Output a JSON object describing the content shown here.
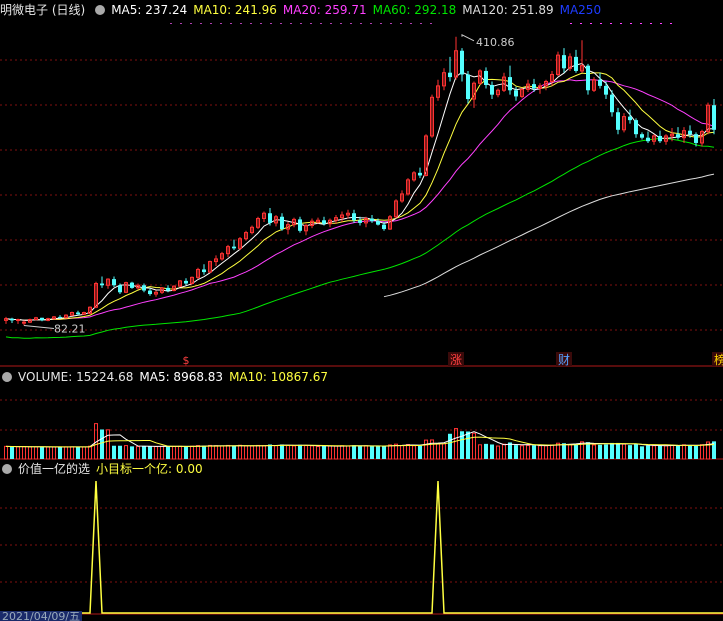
{
  "colors": {
    "up": "#ff3232",
    "down": "#54ffff",
    "grid": "#7f1010",
    "ma5": "#ffffff",
    "ma10": "#ffff40",
    "ma20": "#ff40ff",
    "ma60": "#00e600",
    "ma120": "#dcdcdc",
    "ma250": "#1e3cff",
    "signal": "#ffff40"
  },
  "header": {
    "stock_name": "明微电子 (日线)",
    "ma5": "MA5: 237.24",
    "ma10": "MA10: 241.96",
    "ma20": "MA20: 259.71",
    "ma60": "MA60: 292.18",
    "ma120": "MA120: 251.89",
    "ma250": "MA250"
  },
  "volume_header": {
    "title": "VOLUME: 15224.68",
    "ma5": "MA5: 8968.83",
    "ma10": "MA10: 10867.67"
  },
  "indicator_header": {
    "title": "价值一亿的选",
    "value": "小目标一个亿: 0.00"
  },
  "markers": [
    {
      "label": "$",
      "color": "#ff4040",
      "bar": 30
    },
    {
      "label": "涨",
      "color": "#ff4040",
      "bar": 75
    },
    {
      "label": "财",
      "color": "#54a0ff",
      "bar": 93
    },
    {
      "label": "榜",
      "color": "#ffd700",
      "bar": 119
    }
  ],
  "date_label": "2021/04/09/五",
  "chart_data": [
    {
      "type": "candlestick",
      "title": "明微电子 (日线)",
      "ylim": [
        60,
        430
      ],
      "annotations": [
        {
          "text": "410.86",
          "bar": 76,
          "value": 410.86,
          "kind": "high"
        },
        {
          "text": "82.21",
          "bar": 3,
          "value": 82.21,
          "kind": "low"
        }
      ],
      "series": [
        {
          "name": "MA5",
          "value": 237.24
        },
        {
          "name": "MA10",
          "value": 241.96
        },
        {
          "name": "MA20",
          "value": 259.71
        },
        {
          "name": "MA60",
          "value": 292.18
        },
        {
          "name": "MA120",
          "value": 251.89
        },
        {
          "name": "MA250"
        }
      ],
      "ohlc": [
        [
          88,
          92,
          84,
          90
        ],
        [
          90,
          91,
          85,
          88
        ],
        [
          88,
          90,
          84,
          89
        ],
        [
          85,
          88,
          82.21,
          86
        ],
        [
          86,
          90,
          85,
          89
        ],
        [
          89,
          92,
          88,
          91
        ],
        [
          91,
          91,
          87,
          88
        ],
        [
          88,
          91,
          87,
          90
        ],
        [
          90,
          93,
          89,
          92
        ],
        [
          92,
          94,
          90,
          91
        ],
        [
          91,
          95,
          90,
          94
        ],
        [
          94,
          98,
          93,
          97
        ],
        [
          97,
          99,
          94,
          95
        ],
        [
          95,
          98,
          94,
          97
        ],
        [
          96,
          104,
          95,
          103
        ],
        [
          103,
          132,
          102,
          130
        ],
        [
          130,
          138,
          125,
          128
        ],
        [
          128,
          136,
          124,
          135
        ],
        [
          135,
          138,
          126,
          128
        ],
        [
          128,
          130,
          118,
          120
        ],
        [
          120,
          132,
          119,
          131
        ],
        [
          131,
          132,
          124,
          125
        ],
        [
          125,
          130,
          123,
          128
        ],
        [
          128,
          130,
          120,
          122
        ],
        [
          122,
          124,
          116,
          118
        ],
        [
          118,
          122,
          115,
          120
        ],
        [
          120,
          126,
          118,
          125
        ],
        [
          125,
          128,
          120,
          122
        ],
        [
          122,
          128,
          121,
          127
        ],
        [
          127,
          134,
          126,
          133
        ],
        [
          133,
          136,
          128,
          130
        ],
        [
          130,
          138,
          129,
          137
        ],
        [
          137,
          148,
          135,
          146
        ],
        [
          146,
          152,
          140,
          143
        ],
        [
          143,
          156,
          142,
          155
        ],
        [
          155,
          162,
          150,
          158
        ],
        [
          158,
          166,
          156,
          164
        ],
        [
          164,
          174,
          160,
          172
        ],
        [
          172,
          180,
          168,
          170
        ],
        [
          170,
          183,
          168,
          181
        ],
        [
          181,
          190,
          179,
          188
        ],
        [
          188,
          196,
          186,
          194
        ],
        [
          194,
          206,
          192,
          204
        ],
        [
          204,
          212,
          200,
          210
        ],
        [
          210,
          216,
          196,
          199
        ],
        [
          199,
          208,
          195,
          206
        ],
        [
          206,
          210,
          190,
          192
        ],
        [
          192,
          200,
          186,
          197
        ],
        [
          197,
          205,
          194,
          203
        ],
        [
          203,
          206,
          188,
          190
        ],
        [
          190,
          198,
          185,
          196
        ],
        [
          196,
          204,
          193,
          201
        ],
        [
          200,
          205,
          198,
          202
        ],
        [
          202,
          206,
          196,
          198
        ],
        [
          198,
          204,
          194,
          202
        ],
        [
          202,
          208,
          198,
          205
        ],
        [
          205,
          212,
          200,
          208
        ],
        [
          208,
          214,
          204,
          210
        ],
        [
          210,
          214,
          199,
          202
        ],
        [
          202,
          206,
          196,
          199
        ],
        [
          199,
          206,
          194,
          204
        ],
        [
          204,
          208,
          199,
          201
        ],
        [
          201,
          204,
          196,
          197
        ],
        [
          197,
          200,
          190,
          192
        ],
        [
          192,
          208,
          191,
          206
        ],
        [
          206,
          226,
          204,
          224
        ],
        [
          224,
          236,
          222,
          232
        ],
        [
          232,
          250,
          230,
          248
        ],
        [
          248,
          258,
          246,
          256
        ],
        [
          256,
          262,
          250,
          253
        ],
        [
          253,
          300,
          252,
          298
        ],
        [
          298,
          345,
          296,
          342
        ],
        [
          342,
          362,
          338,
          355
        ],
        [
          355,
          375,
          350,
          370
        ],
        [
          370,
          388,
          360,
          365
        ],
        [
          365,
          410.86,
          362,
          395
        ],
        [
          395,
          398,
          360,
          368
        ],
        [
          368,
          372,
          335,
          340
        ],
        [
          340,
          360,
          330,
          358
        ],
        [
          358,
          374,
          356,
          372
        ],
        [
          372,
          376,
          352,
          356
        ],
        [
          356,
          360,
          340,
          345
        ],
        [
          345,
          352,
          342,
          350
        ],
        [
          350,
          370,
          348,
          365
        ],
        [
          365,
          378,
          345,
          350
        ],
        [
          350,
          354,
          338,
          343
        ],
        [
          343,
          353,
          341,
          351
        ],
        [
          351,
          362,
          348,
          357
        ],
        [
          357,
          363,
          348,
          352
        ],
        [
          352,
          358,
          346,
          355
        ],
        [
          355,
          362,
          350,
          360
        ],
        [
          360,
          372,
          355,
          368
        ],
        [
          368,
          394,
          366,
          390
        ],
        [
          390,
          398,
          370,
          375
        ],
        [
          375,
          392,
          372,
          388
        ],
        [
          388,
          396,
          370,
          372
        ],
        [
          372,
          407,
          370,
          378
        ],
        [
          378,
          380,
          345,
          350
        ],
        [
          350,
          365,
          348,
          362
        ],
        [
          362,
          370,
          352,
          355
        ],
        [
          355,
          360,
          340,
          345
        ],
        [
          345,
          350,
          320,
          325
        ],
        [
          325,
          330,
          300,
          305
        ],
        [
          305,
          324,
          302,
          320
        ],
        [
          320,
          328,
          312,
          316
        ],
        [
          316,
          318,
          296,
          300
        ],
        [
          300,
          302,
          294,
          296
        ],
        [
          296,
          303,
          290,
          292
        ],
        [
          292,
          300,
          288,
          298
        ],
        [
          298,
          304,
          290,
          292
        ],
        [
          292,
          300,
          288,
          298
        ],
        [
          298,
          307,
          292,
          300
        ],
        [
          300,
          308,
          294,
          296
        ],
        [
          296,
          308,
          290,
          304
        ],
        [
          304,
          310,
          296,
          300
        ],
        [
          300,
          302,
          286,
          290
        ],
        [
          290,
          305,
          286,
          303
        ],
        [
          303,
          336,
          300,
          333
        ],
        [
          333,
          340,
          300,
          305
        ]
      ]
    },
    {
      "type": "bar",
      "title": "VOLUME",
      "ylim": [
        0,
        26000
      ],
      "series": [
        {
          "name": "VOLUME",
          "value": 15224.68
        },
        {
          "name": "MA5",
          "value": 8968.83
        },
        {
          "name": "MA10",
          "value": 10867.67
        }
      ]
    },
    {
      "type": "line",
      "title": "价值一亿的选",
      "ylim": [
        0,
        1
      ],
      "series": [
        {
          "name": "小目标一个亿",
          "value": 0.0,
          "spikes_at": [
            15,
            72
          ]
        }
      ]
    }
  ]
}
